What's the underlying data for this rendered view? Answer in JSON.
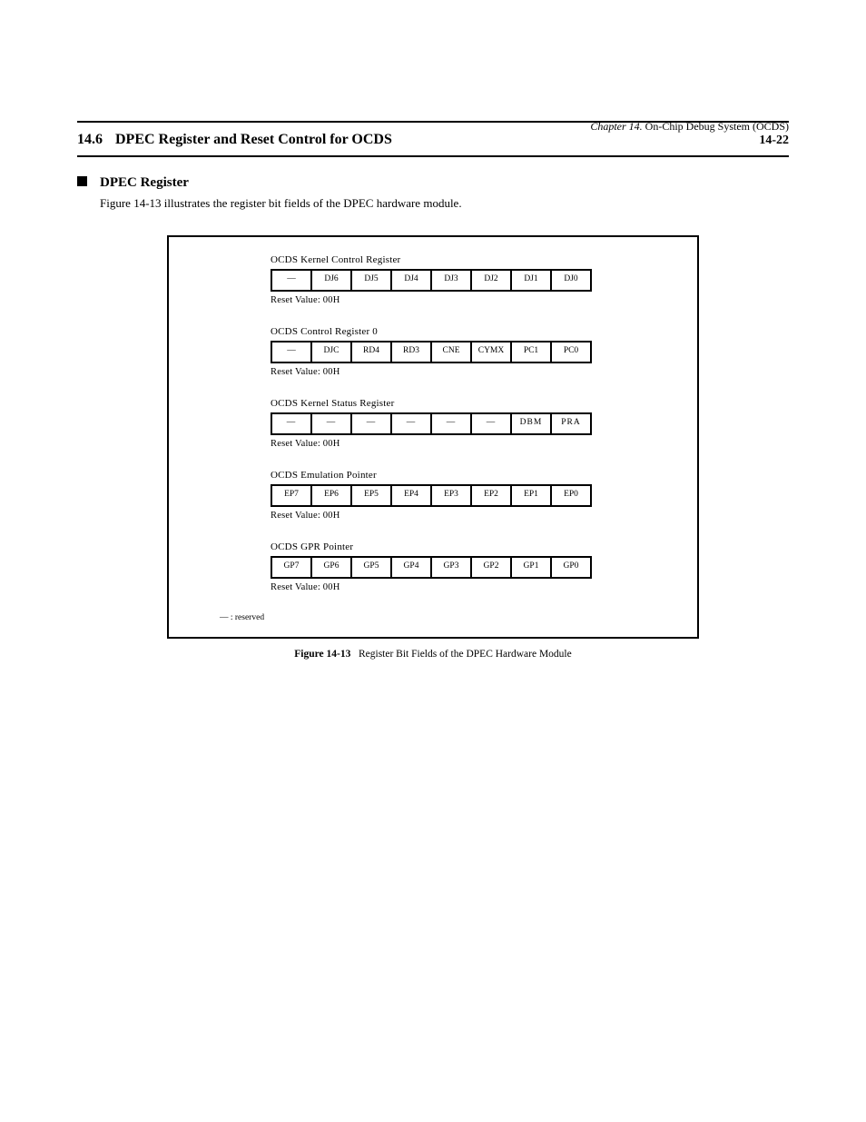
{
  "header": {
    "chapter_label": "Chapter 14.",
    "chapter_title": "On-Chip Debug System (OCDS)",
    "section_number": "14.6",
    "section_title": "DPEC Register and Reset Control for OCDS",
    "page_number": "14-22"
  },
  "bullet": {
    "label": "DPEC Register",
    "body": "Figure 14-13 illustrates the register bit fields of the DPEC hardware module."
  },
  "figure": {
    "registers": [
      {
        "title": "OCDS Kernel Control Register",
        "reset_label": "Reset Value: 00H",
        "cells": [
          "—",
          "DJ6",
          "DJ5",
          "DJ4",
          "DJ3",
          "DJ2",
          "DJ1",
          "DJ0"
        ]
      },
      {
        "title": "OCDS Control Register 0",
        "reset_label": "Reset Value: 00H",
        "cells": [
          "—",
          "DJC",
          "RD4",
          "RD3",
          "CNE",
          "CYMX",
          "PC1",
          "PC0"
        ]
      },
      {
        "title": "OCDS Kernel Status Register",
        "reset_label": "Reset Value: 00H",
        "cells": [
          "—",
          "—",
          "—",
          "—",
          "—",
          "—",
          "DBM",
          "PRA"
        ]
      },
      {
        "title": "OCDS Emulation Pointer",
        "reset_label": "Reset Value: 00H",
        "cells": [
          "EP7",
          "EP6",
          "EP5",
          "EP4",
          "EP3",
          "EP2",
          "EP1",
          "EP0"
        ]
      },
      {
        "title": "OCDS GPR Pointer",
        "reset_label": "Reset Value: 00H",
        "cells": [
          "GP7",
          "GP6",
          "GP5",
          "GP4",
          "GP3",
          "GP2",
          "GP1",
          "GP0"
        ]
      }
    ],
    "footnote": "— : reserved",
    "caption_label": "Figure 14-13",
    "caption_text": "Register Bit Fields of the DPEC Hardware Module"
  }
}
